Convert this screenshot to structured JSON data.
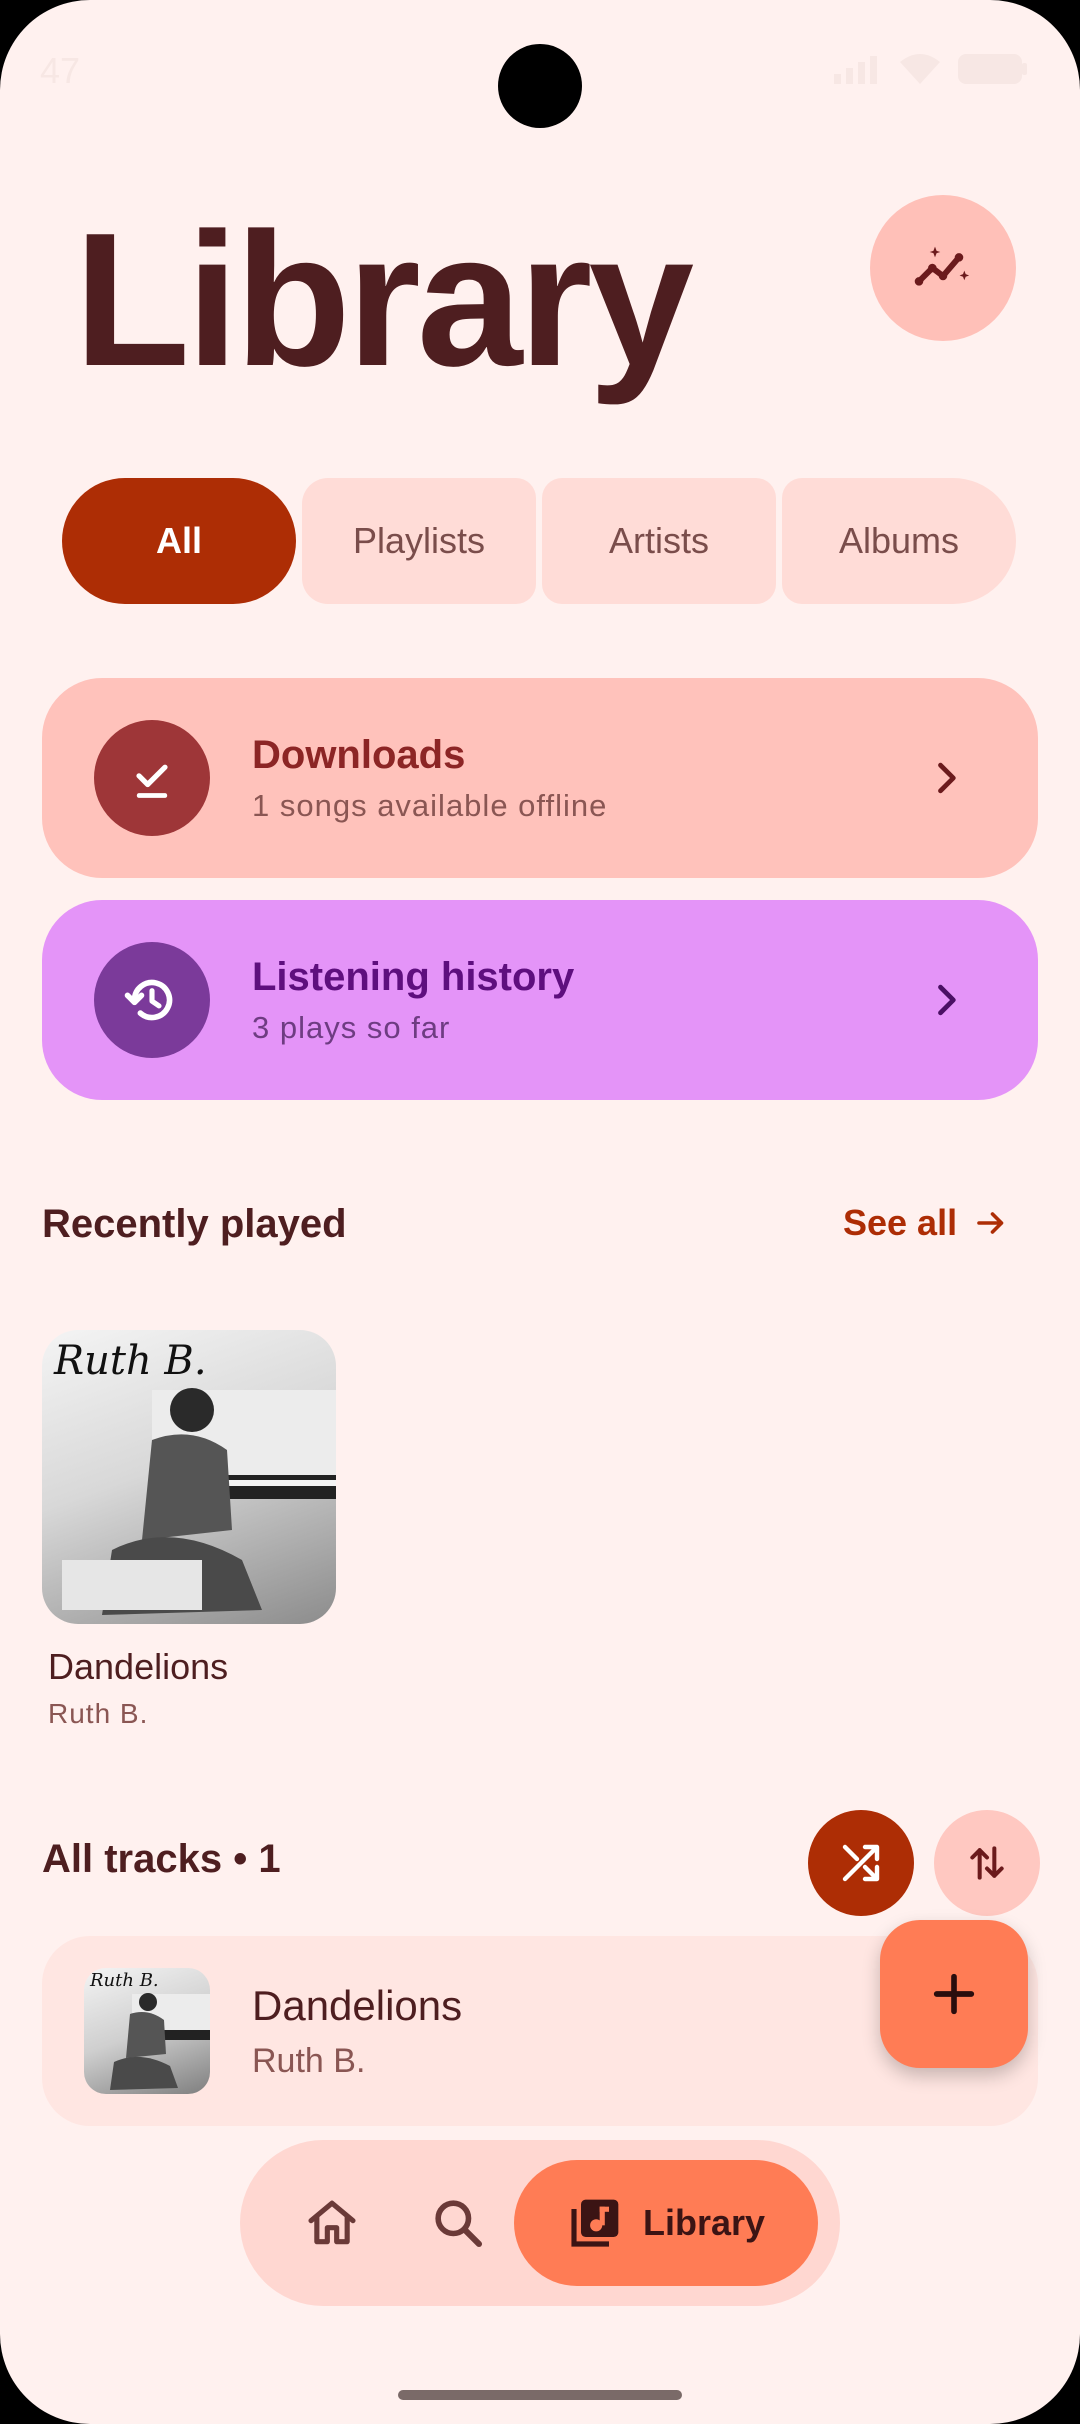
{
  "status_bar": {
    "time": "47"
  },
  "header": {
    "title": "Library"
  },
  "chips": [
    {
      "label": "All",
      "selected": true
    },
    {
      "label": "Playlists",
      "selected": false
    },
    {
      "label": "Artists",
      "selected": false
    },
    {
      "label": "Albums",
      "selected": false
    }
  ],
  "downloads_card": {
    "title": "Downloads",
    "subtitle": "1 songs available offline"
  },
  "history_card": {
    "title": "Listening history",
    "subtitle": "3 plays so far"
  },
  "recently_played": {
    "heading": "Recently played",
    "see_all": "See all",
    "items": [
      {
        "title": "Dandelions",
        "artist": "Ruth B.",
        "cover_text": "Ruth B."
      }
    ]
  },
  "all_tracks": {
    "heading": "All tracks • 1",
    "tracks": [
      {
        "title": "Dandelions",
        "artist": "Ruth B.",
        "cover_text": "Ruth B."
      }
    ]
  },
  "bottom_nav": {
    "library_label": "Library",
    "active": "library"
  },
  "colors": {
    "accent": "#ad2d05",
    "fab": "#ff7c55",
    "background": "#fff1ef"
  },
  "icons": [
    "insights-icon",
    "check-download-icon",
    "history-icon",
    "chevron-right-icon",
    "arrow-right-icon",
    "shuffle-icon",
    "sort-icon",
    "add-icon",
    "home-icon",
    "search-icon",
    "library-music-icon"
  ]
}
